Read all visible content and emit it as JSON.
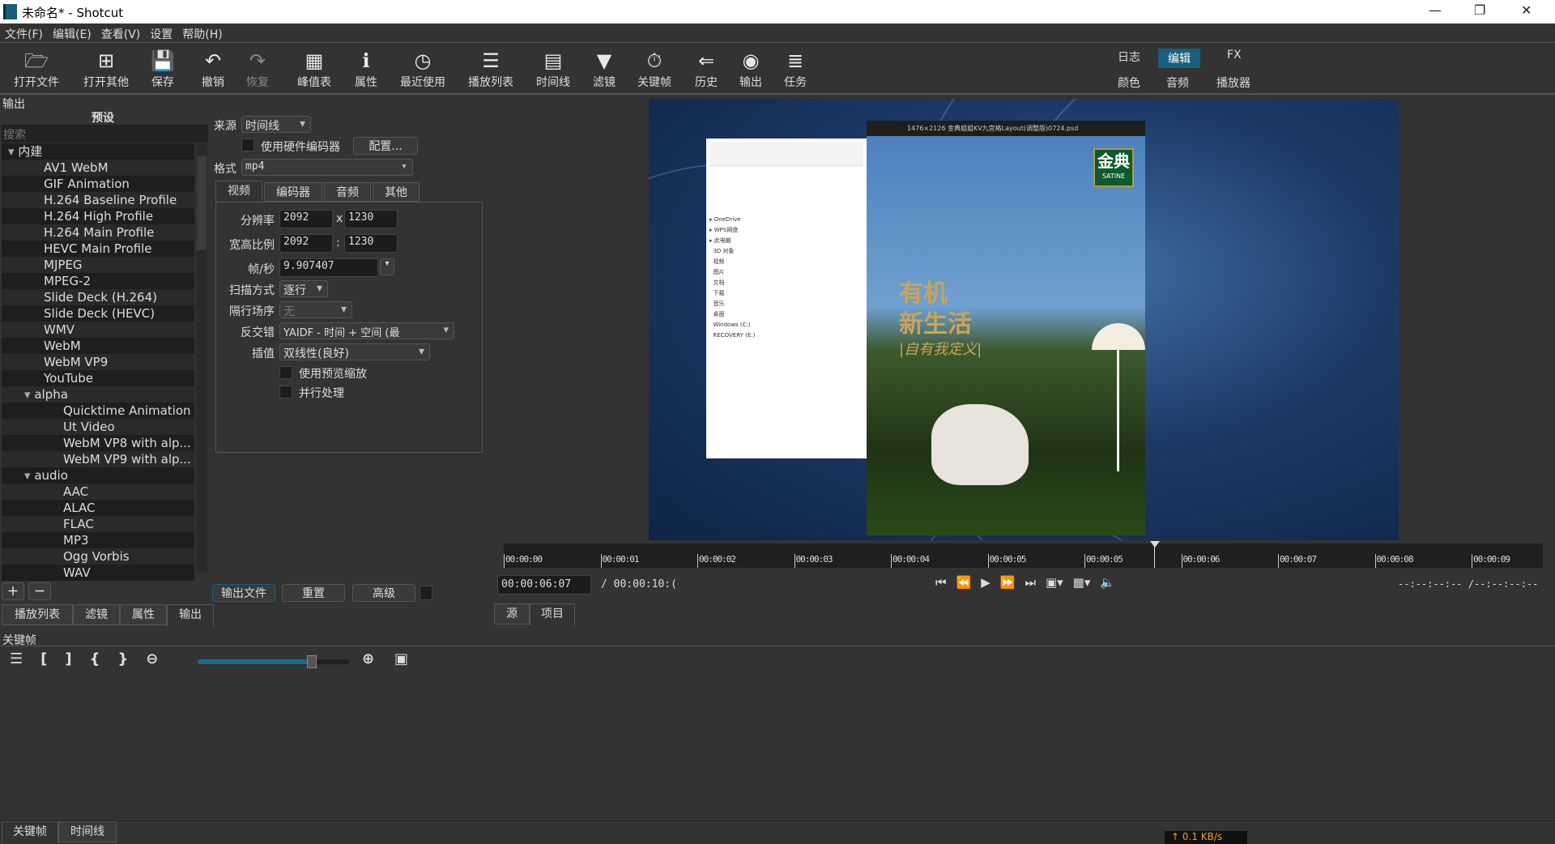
{
  "window": {
    "title": "未命名* - Shotcut",
    "minimize": "—",
    "restore": "❐",
    "close": "✕"
  },
  "menu": [
    "文件(F)",
    "编辑(E)",
    "查看(V)",
    "设置",
    "帮助(H)"
  ],
  "toolbar": [
    {
      "label": "打开文件",
      "icon": "folder-open-icon",
      "glyph": "🗁"
    },
    {
      "label": "打开其他",
      "icon": "open-other-icon",
      "glyph": "⊞"
    },
    {
      "label": "保存",
      "icon": "save-icon",
      "glyph": "💾"
    },
    {
      "label": "撤销",
      "icon": "undo-icon",
      "glyph": "↶"
    },
    {
      "label": "恢复",
      "icon": "redo-icon",
      "glyph": "↷",
      "disabled": true
    },
    {
      "label": "峰值表",
      "icon": "peak-meter-icon",
      "glyph": "▦"
    },
    {
      "label": "属性",
      "icon": "info-icon",
      "glyph": "ℹ"
    },
    {
      "label": "最近使用",
      "icon": "clock-icon",
      "glyph": "◷"
    },
    {
      "label": "播放列表",
      "icon": "playlist-icon",
      "glyph": "☰"
    },
    {
      "label": "时间线",
      "icon": "timeline-icon",
      "glyph": "▤"
    },
    {
      "label": "滤镜",
      "icon": "filter-icon",
      "glyph": "▼"
    },
    {
      "label": "关键帧",
      "icon": "stopwatch-icon",
      "glyph": "⏱"
    },
    {
      "label": "历史",
      "icon": "history-icon",
      "glyph": "⇐"
    },
    {
      "label": "输出",
      "icon": "disc-icon",
      "glyph": "◉"
    },
    {
      "label": "任务",
      "icon": "jobs-icon",
      "glyph": "≣"
    }
  ],
  "layouts": {
    "row1": [
      "日志",
      "编辑",
      "FX"
    ],
    "row2": [
      "颜色",
      "音频",
      "播放器"
    ],
    "active": "编辑"
  },
  "accent": "#1a5f7e",
  "export": {
    "panel_title": "输出",
    "presets_header": "预设",
    "search_placeholder": "搜索",
    "presets": [
      {
        "label": "内建",
        "level": 0,
        "group": true
      },
      {
        "label": "AV1 WebM",
        "level": 1
      },
      {
        "label": "GIF Animation",
        "level": 1
      },
      {
        "label": "H.264 Baseline Profile",
        "level": 1
      },
      {
        "label": "H.264 High Profile",
        "level": 1
      },
      {
        "label": "H.264 Main Profile",
        "level": 1
      },
      {
        "label": "HEVC Main Profile",
        "level": 1
      },
      {
        "label": "MJPEG",
        "level": 1
      },
      {
        "label": "MPEG-2",
        "level": 1
      },
      {
        "label": "Slide Deck (H.264)",
        "level": 1
      },
      {
        "label": "Slide Deck (HEVC)",
        "level": 1
      },
      {
        "label": "WMV",
        "level": 1
      },
      {
        "label": "WebM",
        "level": 1
      },
      {
        "label": "WebM VP9",
        "level": 1
      },
      {
        "label": "YouTube",
        "level": 1
      },
      {
        "label": "alpha",
        "level": 1,
        "group": true
      },
      {
        "label": "Quicktime Animation",
        "level": 2
      },
      {
        "label": "Ut Video",
        "level": 2
      },
      {
        "label": "WebM VP8 with alp...",
        "level": 2
      },
      {
        "label": "WebM VP9 with alp...",
        "level": 2
      },
      {
        "label": "audio",
        "level": 1,
        "group": true
      },
      {
        "label": "AAC",
        "level": 2
      },
      {
        "label": "ALAC",
        "level": 2
      },
      {
        "label": "FLAC",
        "level": 2
      },
      {
        "label": "MP3",
        "level": 2
      },
      {
        "label": "Ogg Vorbis",
        "level": 2
      },
      {
        "label": "WAV",
        "level": 2
      }
    ],
    "source_label": "来源",
    "source_value": "时间线",
    "hw_encoder_label": "使用硬件编码器",
    "configure_label": "配置...",
    "format_label": "格式",
    "format_value": "mp4",
    "tabs": [
      "视频",
      "编码器",
      "音频",
      "其他"
    ],
    "resolution_label": "分辨率",
    "res_w": "2092",
    "res_x": "x",
    "res_h": "1230",
    "aspect_label": "宽高比例",
    "aspect_w": "2092",
    "aspect_sep": ":",
    "aspect_h": "1230",
    "fps_label": "帧/秒",
    "fps_value": "9.907407",
    "scan_label": "扫描方式",
    "scan_value": "逐行",
    "field_order_label": "隔行场序",
    "field_order_value": "无",
    "deinterlace_label": "反交错",
    "deinterlace_value": "YAIDF - 时间 + 空间 (最",
    "interp_label": "插值",
    "interp_value": "双线性(良好)",
    "preview_scale_label": "使用预览缩放",
    "parallel_label": "并行处理",
    "export_file": "输出文件",
    "reset": "重置",
    "advanced": "高级"
  },
  "left_tabs": [
    "播放列表",
    "滤镜",
    "属性",
    "输出"
  ],
  "player": {
    "ruler": [
      "00:00:00",
      "00:00:01",
      "00:00:02",
      "00:00:03",
      "00:00:04",
      "00:00:05",
      "00:00:05",
      "00:00:06",
      "00:00:07",
      "00:00:08",
      "00:00:09"
    ],
    "current": "00:00:06:07",
    "duration": "/ 00:00:10:(",
    "inout": "--:--:--:-- /--:--:--:--",
    "tabs": [
      "源",
      "项目"
    ],
    "poster": {
      "titlebar": "1476×2126 金典姐姐KV九宫格Layout(调整版)0724.psd",
      "logo": "金典",
      "logo_sub": "SATINE",
      "line1": "有机",
      "line2": "新生活",
      "line3": "|自有我定义|"
    }
  },
  "keyframes": {
    "title": "关键帧",
    "zoom_level": 0.75
  },
  "bottom_tabs": [
    "关键帧",
    "时间线"
  ],
  "net_speed": "↑ 0.1 KB/s"
}
